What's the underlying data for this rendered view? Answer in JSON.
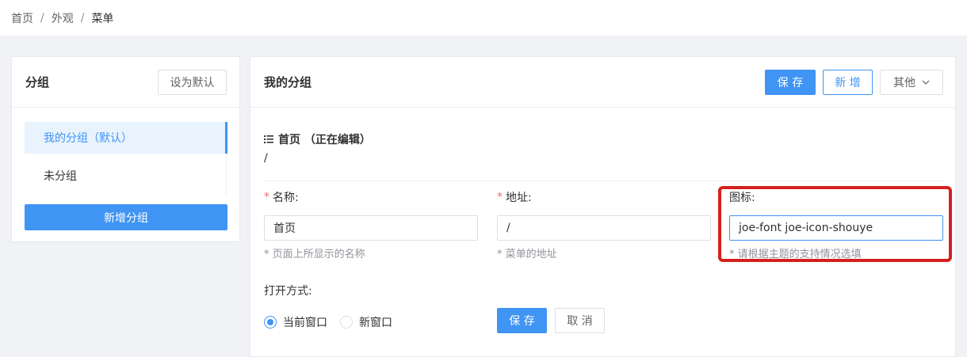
{
  "breadcrumb": {
    "items": [
      "首页",
      "外观",
      "菜单"
    ],
    "separator": "/"
  },
  "left_panel": {
    "title": "分组",
    "set_default_label": "设为默认",
    "groups": [
      {
        "label": "我的分组（默认）",
        "active": true
      },
      {
        "label": "未分组",
        "active": false
      }
    ],
    "add_group_label": "新增分组"
  },
  "right_panel": {
    "title": "我的分组",
    "save_label": "保 存",
    "add_label": "新 增",
    "other_label": "其他",
    "menu_item_title": "首页 （正在编辑）",
    "menu_item_path": "/",
    "fields": {
      "name": {
        "label": "名称:",
        "value": "首页",
        "hint": "* 页面上所显示的名称",
        "required": true
      },
      "url": {
        "label": "地址:",
        "value": "/",
        "hint": "* 菜单的地址",
        "required": true
      },
      "icon": {
        "label": "图标:",
        "value": "joe-font joe-icon-shouye",
        "hint": "* 请根据主题的支持情况选填",
        "required": false
      }
    },
    "open_mode": {
      "label": "打开方式:",
      "options": [
        {
          "label": "当前窗口",
          "checked": true
        },
        {
          "label": "新窗口",
          "checked": false
        }
      ]
    },
    "form_save_label": "保 存",
    "form_cancel_label": "取 消"
  },
  "colors": {
    "primary": "#4094f3",
    "highlight": "#d42020",
    "required": "#f56c6c"
  }
}
